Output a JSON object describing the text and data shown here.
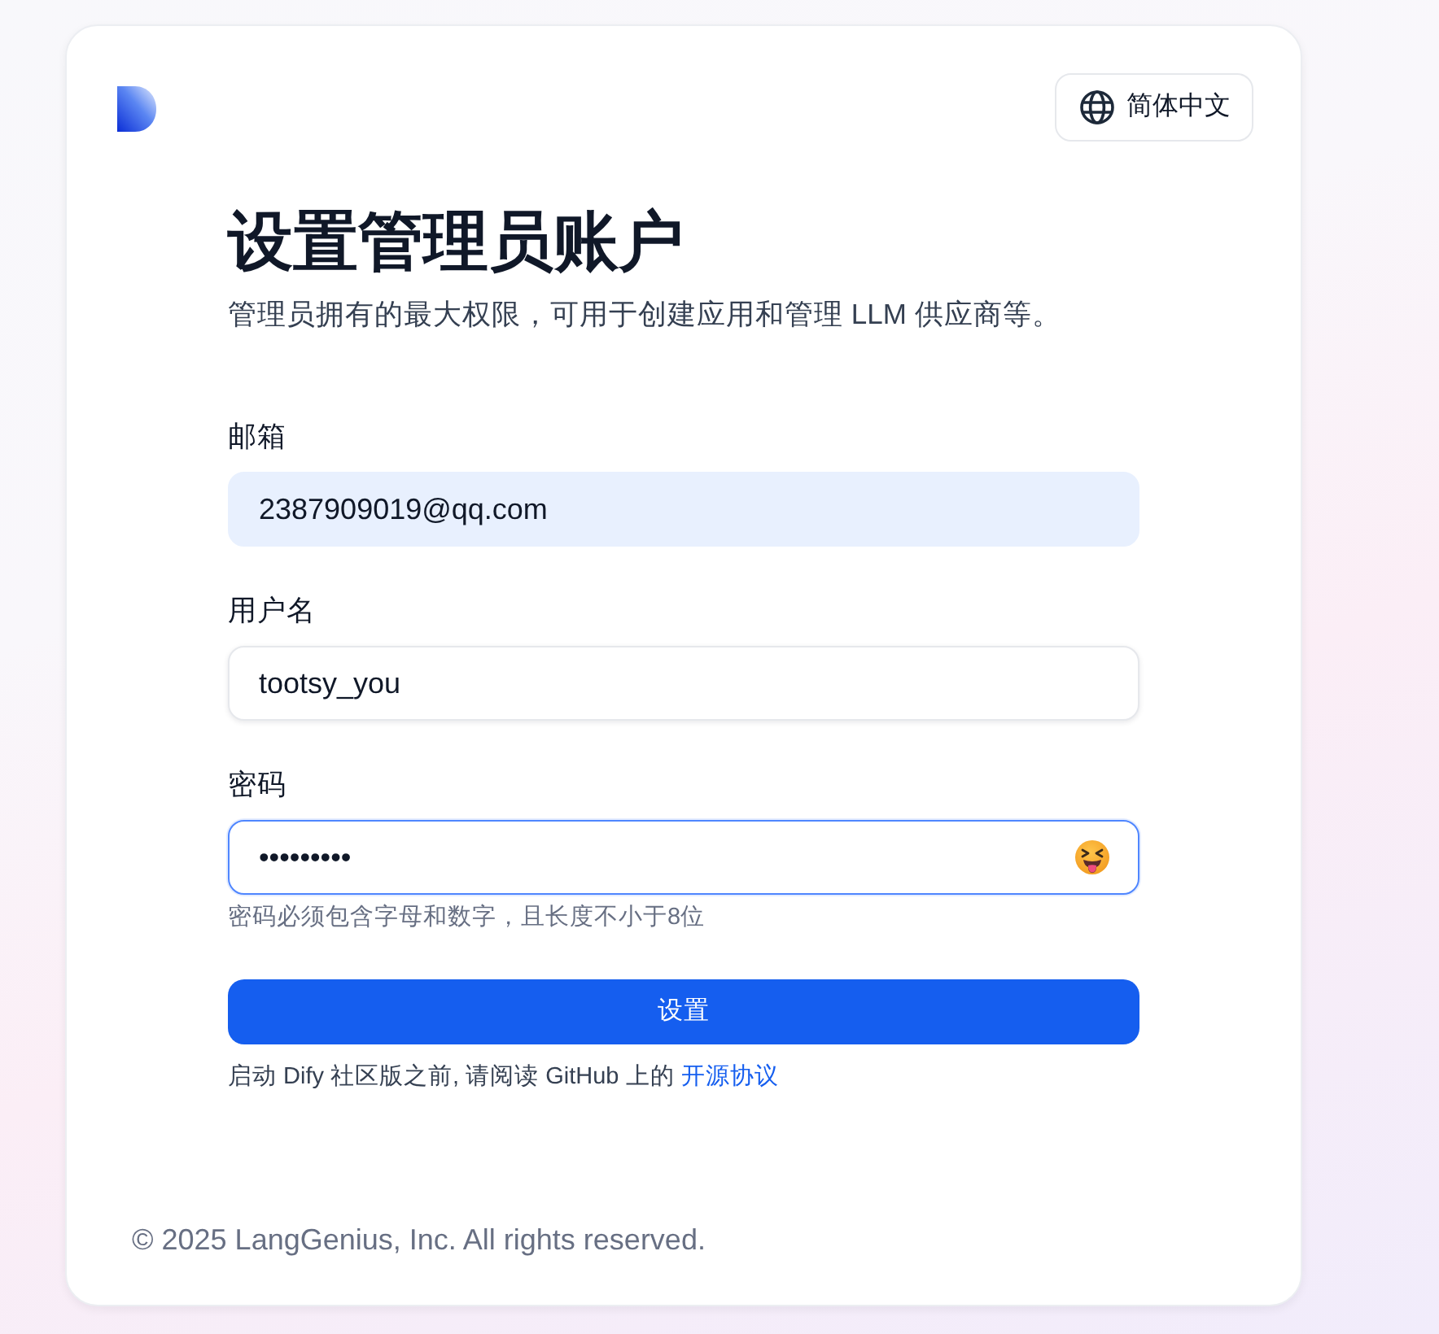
{
  "language_button": {
    "label": "简体中文"
  },
  "heading": {
    "title": "设置管理员账户",
    "subtitle": "管理员拥有的最大权限，可用于创建应用和管理 LLM 供应商等。"
  },
  "fields": [
    {
      "kind": "text",
      "label": "邮箱",
      "value": "2387909019@qq.com",
      "autofilled": true,
      "focused": false
    },
    {
      "kind": "text",
      "label": "用户名",
      "value": "tootsy_you",
      "autofilled": false,
      "focused": false
    },
    {
      "kind": "password",
      "label": "密码",
      "value": "•••••••••",
      "autofilled": false,
      "focused": true,
      "hint": "密码必须包含字母和数字，且长度不小于8位"
    }
  ],
  "submit_button": {
    "label": "设置"
  },
  "notice": {
    "text": "启动 Dify 社区版之前, 请阅读 GitHub 上的",
    "link": "开源协议"
  },
  "footer": {
    "copyright": "© 2025 LangGenius, Inc. All rights reserved."
  }
}
